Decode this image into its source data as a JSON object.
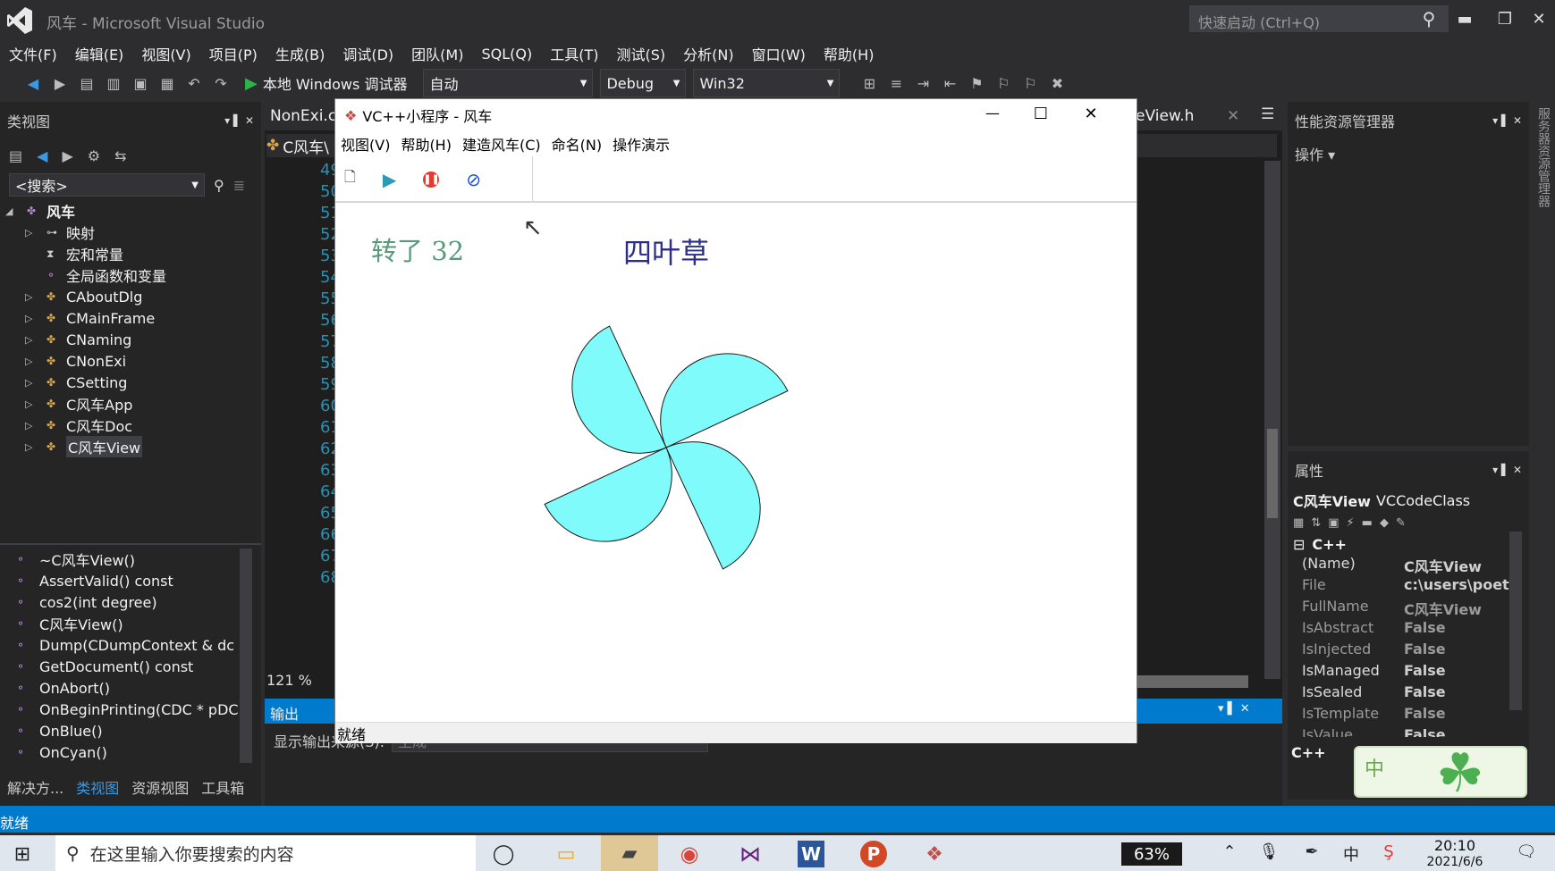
{
  "window": {
    "title": "风车 - Microsoft Visual Studio",
    "quick_launch_placeholder": "快速启动 (Ctrl+Q)"
  },
  "menu": [
    "文件(F)",
    "编辑(E)",
    "视图(V)",
    "项目(P)",
    "生成(B)",
    "调试(D)",
    "团队(M)",
    "SQL(Q)",
    "工具(T)",
    "测试(S)",
    "分析(N)",
    "窗口(W)",
    "帮助(H)"
  ],
  "toolbar": {
    "debugger_label": "本地 Windows 调试器",
    "config_auto": "自动",
    "config_debug": "Debug",
    "platform": "Win32"
  },
  "class_view": {
    "title": "类视图",
    "search_placeholder": "<搜索>",
    "root": "风车",
    "items": [
      "映射",
      "宏和常量",
      "全局函数和变量",
      "CAboutDlg",
      "CMainFrame",
      "CNaming",
      "CNonExi",
      "CSetting",
      "C风车App",
      "C风车Doc",
      "C风车View"
    ],
    "members": [
      "~C风车View()",
      "AssertValid() const",
      "cos2(int degree)",
      "C风车View()",
      "Dump(CDumpContext & dc",
      "GetDocument() const",
      "OnAbort()",
      "OnBeginPrinting(CDC * pDC",
      "OnBlue()",
      "OnCyan()"
    ],
    "bottom_tabs": [
      "解决方...",
      "类视图",
      "资源视图",
      "工具箱"
    ]
  },
  "editor": {
    "tab1": "NonExi.c",
    "tab2": "eView.h",
    "class_combo": "C风车\\",
    "line_numbers": [
      "49",
      "50",
      "51",
      "52",
      "53",
      "54",
      "55",
      "56",
      "57",
      "58",
      "59",
      "60",
      "61",
      "62",
      "63",
      "64",
      "65",
      "66",
      "67",
      "68"
    ],
    "zoom": "121 %"
  },
  "output": {
    "title": "输出",
    "source_label": "显示输出来源(S):",
    "source_value": "生成"
  },
  "dialog": {
    "title": "VC++小程序 - 风车",
    "menu": [
      "视图(V)",
      "帮助(H)",
      "建造风车(C)",
      "命名(N)",
      "操作演示"
    ],
    "rotation_text": "转了 32",
    "name_text": "四叶草",
    "status": "就绪",
    "blade_color": "#7ffbfb"
  },
  "perf": {
    "title": "性能资源管理器",
    "action": "操作"
  },
  "properties": {
    "title": "属性",
    "object": "C风车View",
    "object_type": "VCCodeClass",
    "group": "C++",
    "rows": [
      {
        "k": "(Name)",
        "v": "C风车View"
      },
      {
        "k": "File",
        "v": "c:\\users\\poetr"
      },
      {
        "k": "FullName",
        "v": "C风车View"
      },
      {
        "k": "IsAbstract",
        "v": "False"
      },
      {
        "k": "IsInjected",
        "v": "False"
      },
      {
        "k": "IsManaged",
        "v": "False"
      },
      {
        "k": "IsSealed",
        "v": "False"
      },
      {
        "k": "IsTemplate",
        "v": "False"
      },
      {
        "k": "IsValue",
        "v": "False"
      }
    ],
    "footer": "C++"
  },
  "right_strip": "服务器资源管理器",
  "status_bar": "就绪",
  "taskbar": {
    "search_placeholder": "在这里输入你要搜索的内容",
    "battery": "63%",
    "time": "20:10",
    "date": "2021/6/6",
    "ime": "中"
  },
  "colors": {
    "accent": "#007acc",
    "vs_purple": "#68217a"
  }
}
